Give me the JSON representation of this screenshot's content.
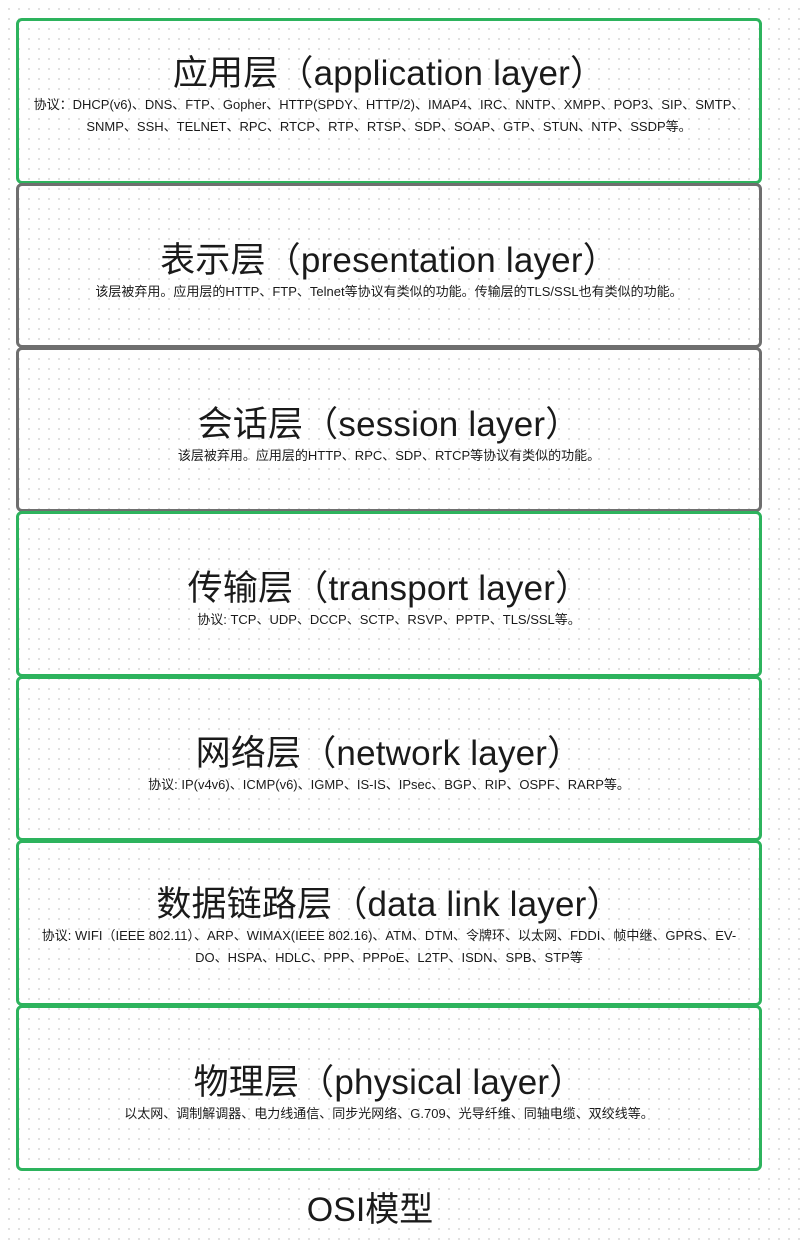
{
  "colors": {
    "green_border": "#2db35d",
    "gray_border": "#6f6f6f",
    "text": "#1a1a1a",
    "dot_grid": "#d9d9d9"
  },
  "layers": [
    {
      "title": "应用层（application layer）",
      "description": "协议：DHCP(v6)、DNS、FTP、Gopher、HTTP(SPDY、HTTP/2)、IMAP4、IRC、NNTP、XMPP、POP3、SIP、SMTP、SNMP、SSH、TELNET、RPC、RTCP、RTP、RTSP、SDP、SOAP、GTP、STUN、NTP、SSDP等。",
      "border": "green"
    },
    {
      "title": "表示层（presentation layer）",
      "description": "该层被弃用。应用层的HTTP、FTP、Telnet等协议有类似的功能。传输层的TLS/SSL也有类似的功能。",
      "border": "gray"
    },
    {
      "title": "会话层（session layer）",
      "description": "该层被弃用。应用层的HTTP、RPC、SDP、RTCP等协议有类似的功能。",
      "border": "gray"
    },
    {
      "title": "传输层（transport layer）",
      "description": "协议: TCP、UDP、DCCP、SCTP、RSVP、PPTP、TLS/SSL等。",
      "border": "green"
    },
    {
      "title": "网络层（network layer）",
      "description": "协议: IP(v4v6)、ICMP(v6)、IGMP、IS-IS、IPsec、BGP、RIP、OSPF、RARP等。",
      "border": "green"
    },
    {
      "title": "数据链路层（data link layer）",
      "description": "协议: WIFI（IEEE 802.11）、ARP、WIMAX(IEEE 802.16)、ATM、DTM、令牌环、以太网、FDDI、帧中继、GPRS、EV-DO、HSPA、HDLC、PPP、PPPoE、L2TP、ISDN、SPB、STP等",
      "border": "green"
    },
    {
      "title": "物理层（physical layer）",
      "description": "以太网、调制解调器、电力线通信、同步光网络、G.709、光导纤维、同轴电缆、双绞线等。",
      "border": "green"
    }
  ],
  "caption": "OSI模型"
}
